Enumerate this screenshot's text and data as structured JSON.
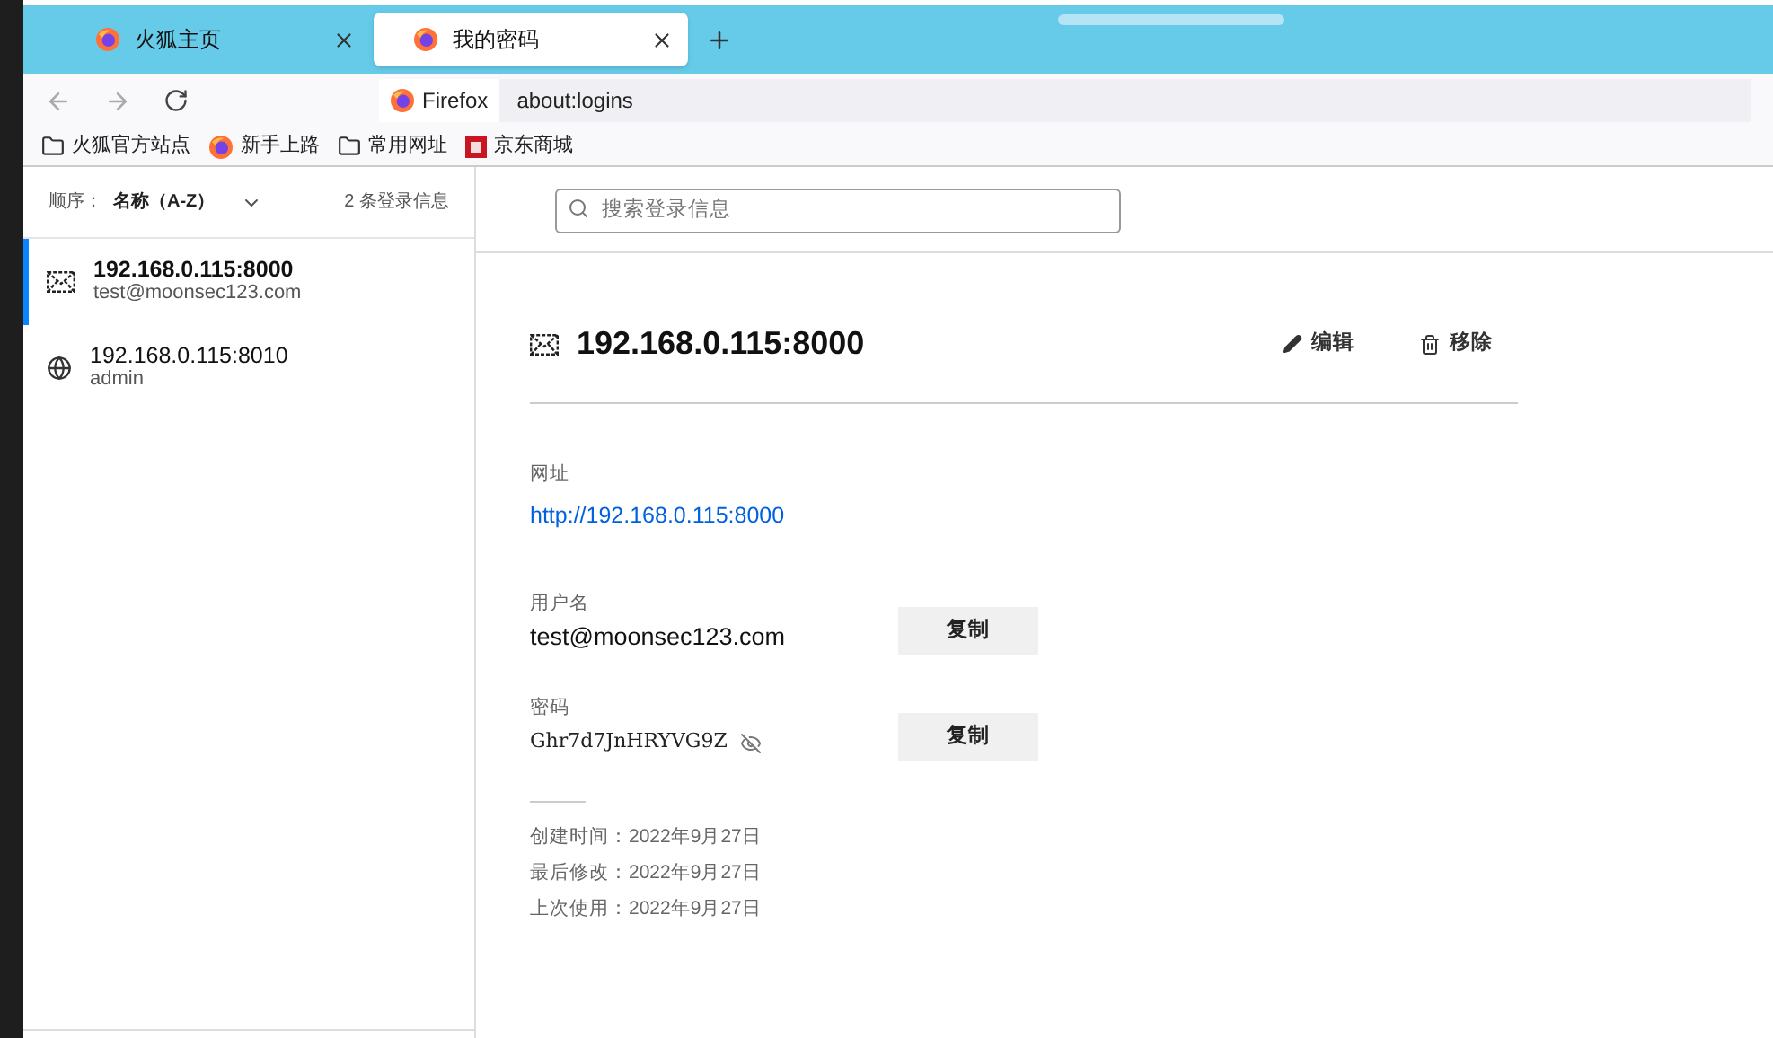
{
  "tabs": [
    {
      "label": "火狐主页",
      "selected": false
    },
    {
      "label": "我的密码",
      "selected": true
    }
  ],
  "address_bar": {
    "identity": "Firefox",
    "url": "about:logins"
  },
  "bookmarks": [
    {
      "kind": "folder",
      "label": "火狐官方站点"
    },
    {
      "kind": "firefox",
      "label": "新手上路"
    },
    {
      "kind": "folder",
      "label": "常用网址"
    },
    {
      "kind": "jd",
      "label": "京东商城"
    }
  ],
  "sidebar": {
    "sort_label": "顺序：",
    "sort_value": "名称（A-Z）",
    "count": "2 条登录信息",
    "logins": [
      {
        "kind": "envelope",
        "origin": "192.168.0.115:8000",
        "username": "test@moonsec123.com",
        "selected": true
      },
      {
        "kind": "globe",
        "origin": "192.168.0.115:8010",
        "username": "admin",
        "selected": false
      }
    ]
  },
  "search": {
    "placeholder": "搜索登录信息"
  },
  "detail": {
    "title": "192.168.0.115:8000",
    "edit": "编辑",
    "remove": "移除",
    "site_label": "网址",
    "site": "http://192.168.0.115:8000",
    "username_label": "用户名",
    "username": "test@moonsec123.com",
    "copy_username": "复制",
    "password_label": "密码",
    "password": "Ghr7d7JnHRYVG9Z",
    "copy_password": "复制",
    "dates": [
      "创建时间：2022年9月27日",
      "最后修改：2022年9月27日",
      "上次使用：2022年9月27日"
    ]
  }
}
